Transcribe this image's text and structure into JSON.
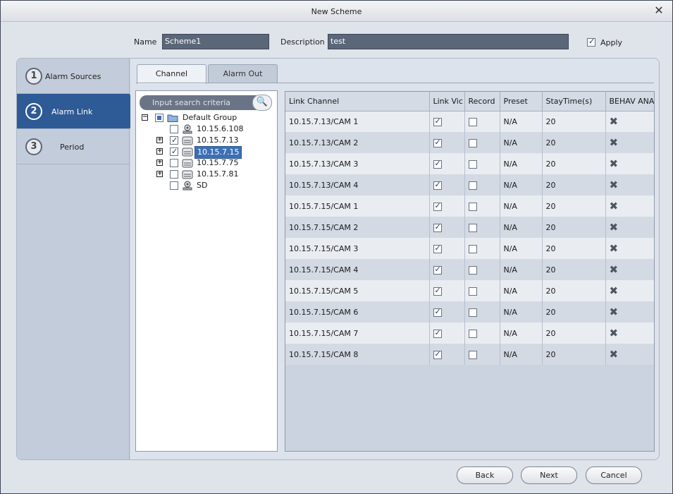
{
  "window": {
    "title": "New Scheme"
  },
  "header": {
    "name_label": "Name",
    "name_value": "Scheme1",
    "description_label": "Description",
    "description_value": "test",
    "apply_label": "Apply",
    "apply_checked": true
  },
  "steps": [
    {
      "number": "1",
      "label": "Alarm Sources"
    },
    {
      "number": "2",
      "label": "Alarm Link"
    },
    {
      "number": "3",
      "label": "Period"
    }
  ],
  "tabs": {
    "channel": "Channel",
    "alarm_out": "Alarm Out"
  },
  "search": {
    "placeholder": "Input search criteria"
  },
  "tree": {
    "group": "Default Group",
    "devices": [
      "10.15.6.108",
      "10.15.7.13",
      "10.15.7.15",
      "10.15.7.75",
      "10.15.7.81",
      "SD"
    ]
  },
  "grid": {
    "columns": [
      "Link Channel",
      "Link Vic",
      "Record",
      "Preset",
      "StayTime(s)",
      "BEHAV ANA"
    ],
    "rows": [
      {
        "channel": "10.15.7.13/CAM 1",
        "preset": "N/A",
        "stay": "20"
      },
      {
        "channel": "10.15.7.13/CAM 2",
        "preset": "N/A",
        "stay": "20"
      },
      {
        "channel": "10.15.7.13/CAM 3",
        "preset": "N/A",
        "stay": "20"
      },
      {
        "channel": "10.15.7.13/CAM 4",
        "preset": "N/A",
        "stay": "20"
      },
      {
        "channel": "10.15.7.15/CAM 1",
        "preset": "N/A",
        "stay": "20"
      },
      {
        "channel": "10.15.7.15/CAM 2",
        "preset": "N/A",
        "stay": "20"
      },
      {
        "channel": "10.15.7.15/CAM 3",
        "preset": "N/A",
        "stay": "20"
      },
      {
        "channel": "10.15.7.15/CAM 4",
        "preset": "N/A",
        "stay": "20"
      },
      {
        "channel": "10.15.7.15/CAM 5",
        "preset": "N/A",
        "stay": "20"
      },
      {
        "channel": "10.15.7.15/CAM 6",
        "preset": "N/A",
        "stay": "20"
      },
      {
        "channel": "10.15.7.15/CAM 7",
        "preset": "N/A",
        "stay": "20"
      },
      {
        "channel": "10.15.7.15/CAM 8",
        "preset": "N/A",
        "stay": "20"
      }
    ]
  },
  "buttons": {
    "back": "Back",
    "next": "Next",
    "cancel": "Cancel"
  },
  "icons": {
    "close": "close-icon",
    "search": "search-icon",
    "folder": "folder-icon",
    "device": "device-icon",
    "delete": "delete-icon"
  },
  "colors": {
    "active_step": "#2e5a95",
    "field_bg": "#5b6679"
  }
}
